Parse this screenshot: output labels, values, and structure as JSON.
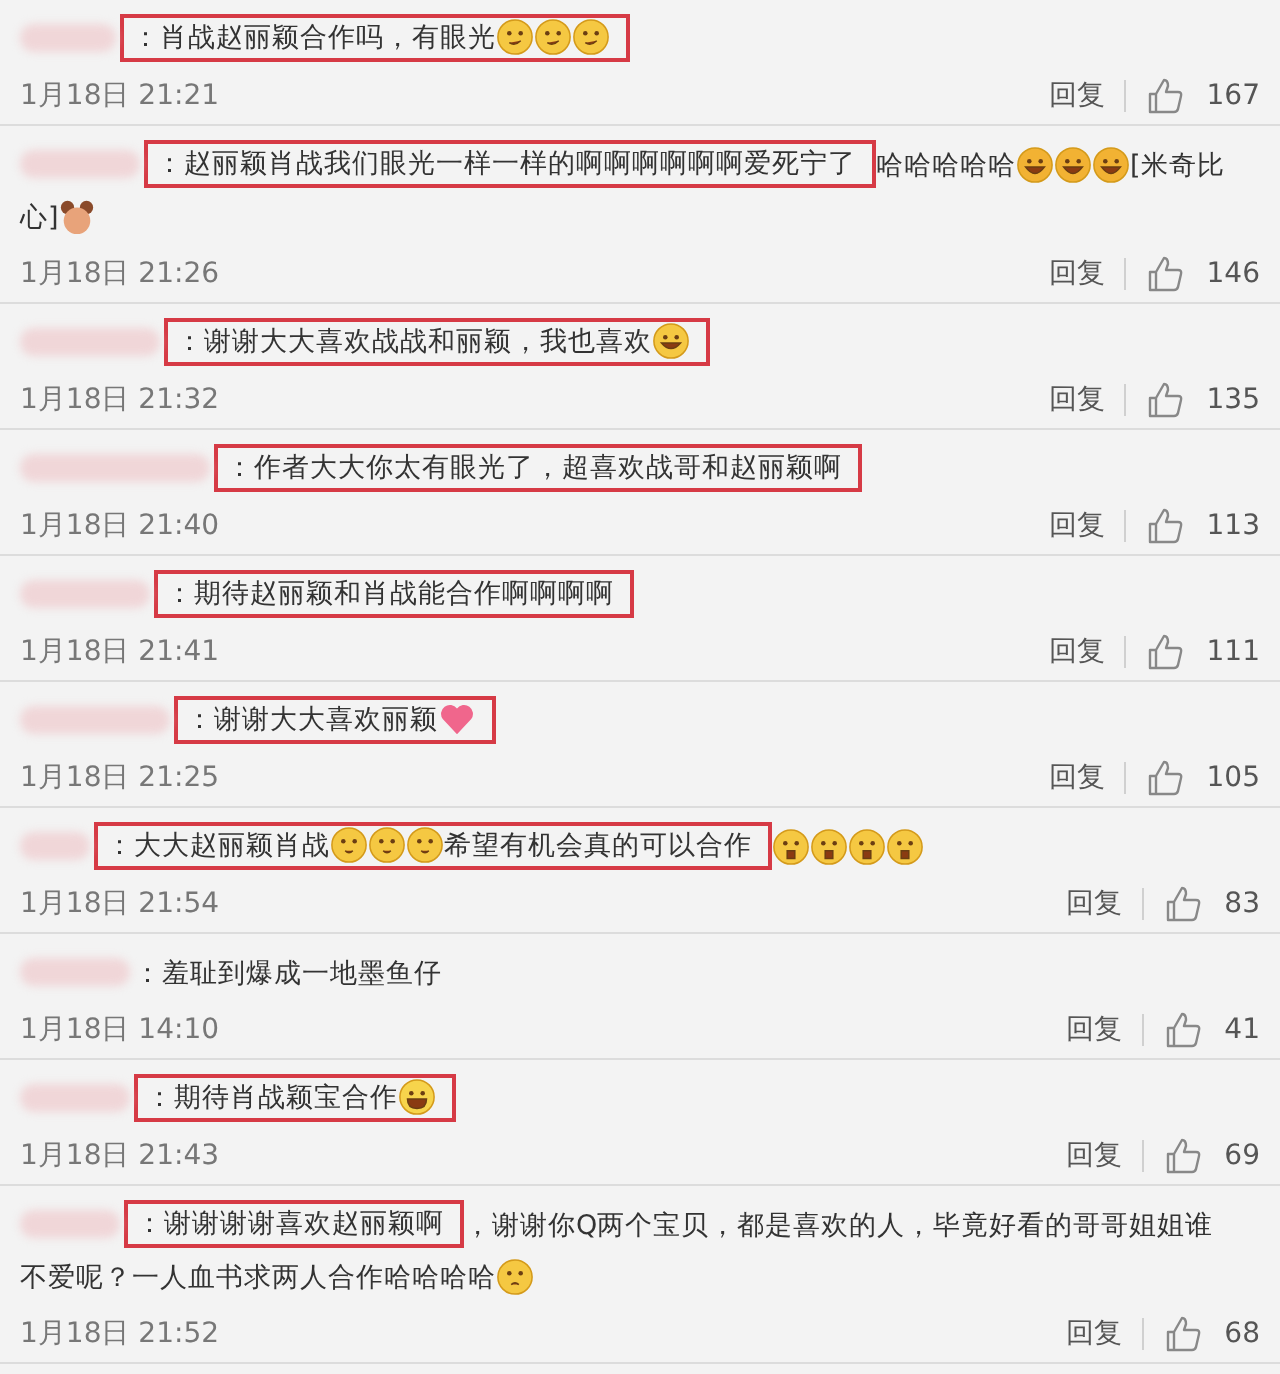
{
  "comments": [
    {
      "boxed": [
        {
          "kind": "text",
          "text": "：肖战赵丽颖合作吗，有眼光"
        },
        {
          "kind": "smirk"
        },
        {
          "kind": "smirk"
        },
        {
          "kind": "smirk"
        }
      ],
      "time": "1月18日 21:21",
      "reply": "回复",
      "likes": "167"
    },
    {
      "boxed": [
        {
          "kind": "text",
          "text": "：赵丽颖肖战我们眼光一样一样的啊啊啊啊啊啊爱死宁了"
        }
      ],
      "rest": [
        {
          "kind": "text",
          "text": "哈哈哈哈哈"
        },
        {
          "kind": "laugh"
        },
        {
          "kind": "laugh"
        },
        {
          "kind": "laugh"
        },
        {
          "kind": "text",
          "text": "[米奇比"
        },
        {
          "kind": "break"
        },
        {
          "kind": "text",
          "text": "心]"
        },
        {
          "kind": "mickey"
        }
      ],
      "time": "1月18日 21:26",
      "reply": "回复",
      "likes": "146"
    },
    {
      "boxed": [
        {
          "kind": "text",
          "text": "：谢谢大大喜欢战战和丽颖，我也喜欢"
        },
        {
          "kind": "cry-laugh"
        }
      ],
      "time": "1月18日 21:32",
      "reply": "回复",
      "likes": "135"
    },
    {
      "boxed": [
        {
          "kind": "text",
          "text": "：作者大大你太有眼光了，超喜欢战哥和赵丽颖啊"
        }
      ],
      "time": "1月18日 21:40",
      "reply": "回复",
      "likes": "113"
    },
    {
      "boxed": [
        {
          "kind": "text",
          "text": "：期待赵丽颖和肖战能合作啊啊啊啊"
        }
      ],
      "time": "1月18日 21:41",
      "reply": "回复",
      "likes": "111"
    },
    {
      "boxed": [
        {
          "kind": "text",
          "text": "：谢谢大大喜欢丽颖"
        },
        {
          "kind": "heart"
        }
      ],
      "time": "1月18日 21:25",
      "reply": "回复",
      "likes": "105"
    },
    {
      "boxed": [
        {
          "kind": "text",
          "text": "：大大赵丽颖肖战"
        },
        {
          "kind": "blush"
        },
        {
          "kind": "blush"
        },
        {
          "kind": "blush"
        },
        {
          "kind": "text",
          "text": "希望有机会真的可以合作"
        }
      ],
      "rest": [
        {
          "kind": "gasp"
        },
        {
          "kind": "gasp"
        },
        {
          "kind": "gasp"
        },
        {
          "kind": "gasp"
        }
      ],
      "time": "1月18日 21:54",
      "reply": "回复",
      "likes": "83"
    },
    {
      "rest": [
        {
          "kind": "text",
          "text": "：羞耻到爆成一地墨鱼仔"
        }
      ],
      "time": "1月18日 14:10",
      "reply": "回复",
      "likes": "41"
    },
    {
      "boxed": [
        {
          "kind": "text",
          "text": "：期待肖战颖宝合作"
        },
        {
          "kind": "grin"
        }
      ],
      "time": "1月18日 21:43",
      "reply": "回复",
      "likes": "69"
    },
    {
      "boxed": [
        {
          "kind": "text",
          "text": "：谢谢谢谢喜欢赵丽颖啊"
        }
      ],
      "rest": [
        {
          "kind": "text",
          "text": "，谢谢你Q两个宝贝，都是喜欢的人，毕竟好看的哥哥姐姐谁"
        },
        {
          "kind": "break"
        },
        {
          "kind": "text",
          "text": "不爱呢？一人血书求两人合作哈哈哈哈"
        },
        {
          "kind": "shy"
        }
      ],
      "time": "1月18日 21:52",
      "reply": "回复",
      "likes": "68"
    }
  ]
}
